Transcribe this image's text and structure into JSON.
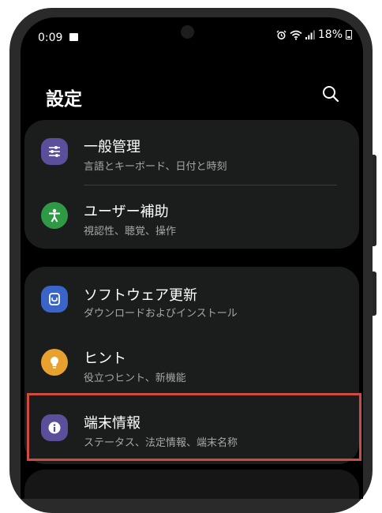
{
  "status_bar": {
    "time": "0:09",
    "battery": "18%"
  },
  "header": {
    "title": "設定"
  },
  "groups": [
    {
      "items": [
        {
          "title": "一般管理",
          "subtitle": "言語とキーボード、日付と時刻",
          "icon": "sliders-icon",
          "color": "#5b4f9c"
        },
        {
          "title": "ユーザー補助",
          "subtitle": "視認性、聴覚、操作",
          "icon": "accessibility-person-icon",
          "color": "#2f9a45"
        }
      ]
    },
    {
      "items": [
        {
          "title": "ソフトウェア更新",
          "subtitle": "ダウンロードおよびインストール",
          "icon": "software-update-icon",
          "color": "#3a64c7"
        },
        {
          "title": "ヒント",
          "subtitle": "役立つヒント、新機能",
          "icon": "lightbulb-icon",
          "color": "#e8a12f"
        },
        {
          "title": "端末情報",
          "subtitle": "ステータス、法定情報、端末名称",
          "icon": "info-icon",
          "color": "#5b4f9c",
          "highlighted": true
        }
      ]
    }
  ],
  "colors": {
    "background": "#000000",
    "card": "#1b1d1c",
    "highlight_border": "#cf4a41"
  }
}
